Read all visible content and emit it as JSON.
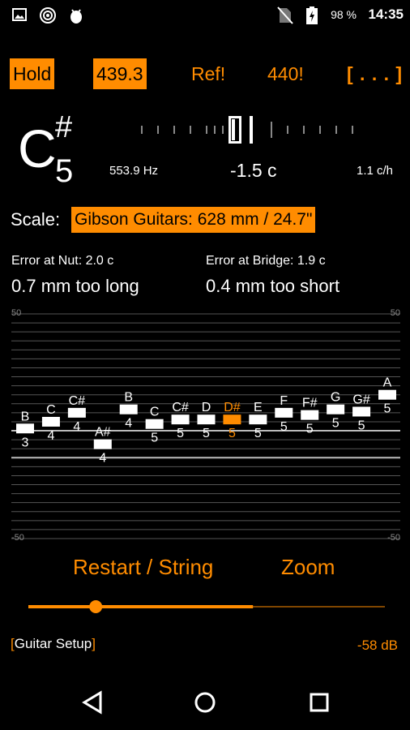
{
  "status_bar": {
    "battery_percent": "98 %",
    "time": "14:35",
    "icons": [
      "image-icon",
      "target-icon",
      "android-debug-icon",
      "no-sim-icon",
      "battery-charging-icon"
    ]
  },
  "toolbar": {
    "hold_label": "Hold",
    "reference_value": "439.3",
    "ref_label": "Ref!",
    "a440_label": "440!",
    "more_label": "[ . . . ]"
  },
  "note": {
    "letter": "C",
    "accidental": "#",
    "octave": "5",
    "frequency": "553.9 Hz",
    "cents": "-1.5 c",
    "rate": "1.1 c/h"
  },
  "scale": {
    "label": "Scale:",
    "value": "Gibson Guitars: 628 mm / 24.7\""
  },
  "errors": {
    "nut_title": "Error at Nut: 2.0 c",
    "nut_value": "0.7 mm too long",
    "bridge_title": "Error at Bridge: 1.9 c",
    "bridge_value": "0.4 mm too short"
  },
  "chart_data": {
    "type": "scatter",
    "ylim": [
      -50,
      50
    ],
    "y_tick_labels": [
      "50",
      "-50"
    ],
    "current_note_index": 8,
    "points": [
      {
        "note": "B",
        "octave": "3",
        "y": -1
      },
      {
        "note": "C",
        "octave": "4",
        "y": 2
      },
      {
        "note": "C#",
        "octave": "4",
        "y": 6
      },
      {
        "note": "A#",
        "octave": "4",
        "y": -8
      },
      {
        "note": "B",
        "octave": "4",
        "y": 7.5
      },
      {
        "note": "C",
        "octave": "5",
        "y": 1
      },
      {
        "note": "C#",
        "octave": "5",
        "y": 3
      },
      {
        "note": "D",
        "octave": "5",
        "y": 3
      },
      {
        "note": "D#",
        "octave": "5",
        "y": 3
      },
      {
        "note": "E",
        "octave": "5",
        "y": 3
      },
      {
        "note": "F",
        "octave": "5",
        "y": 6
      },
      {
        "note": "F#",
        "octave": "5",
        "y": 5
      },
      {
        "note": "G",
        "octave": "5",
        "y": 7.5
      },
      {
        "note": "G#",
        "octave": "5",
        "y": 6.5
      },
      {
        "note": "A",
        "octave": "5",
        "y": 14
      }
    ]
  },
  "controls": {
    "restart_label": "Restart / String",
    "zoom_label": "Zoom",
    "slider_value": 0.18,
    "slider_filled_fraction": 0.63
  },
  "footer": {
    "setup_label": "Guitar Setup",
    "level": "-58 dB"
  },
  "colors": {
    "accent": "#ff8c00",
    "background": "#000000",
    "text": "#ffffff"
  }
}
